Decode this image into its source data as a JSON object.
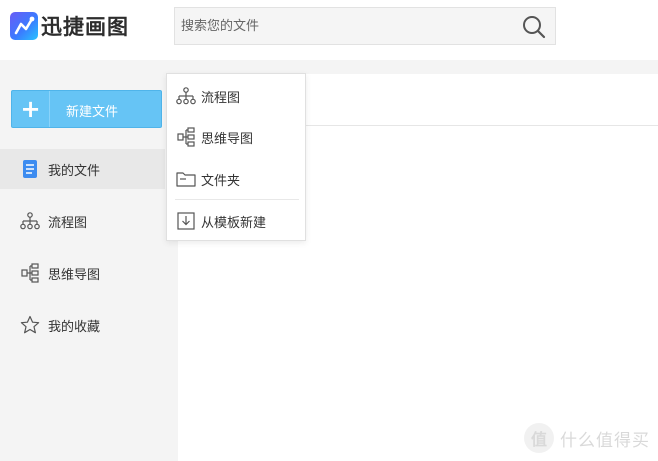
{
  "app": {
    "name": "迅捷画图"
  },
  "search": {
    "placeholder": "搜索您的文件"
  },
  "sidebar": {
    "new_button_label": "新建文件",
    "items": [
      {
        "label": "我的文件",
        "icon": "document-icon",
        "active": true
      },
      {
        "label": "流程图",
        "icon": "flowchart-icon",
        "active": false
      },
      {
        "label": "思维导图",
        "icon": "mindmap-icon",
        "active": false
      },
      {
        "label": "我的收藏",
        "icon": "star-icon",
        "active": false
      }
    ]
  },
  "dropdown": {
    "items": [
      {
        "label": "流程图",
        "icon": "flowchart-icon"
      },
      {
        "label": "思维导图",
        "icon": "mindmap-icon"
      },
      {
        "label": "文件夹",
        "icon": "folder-icon"
      },
      {
        "label": "从模板新建",
        "icon": "template-download-icon"
      }
    ]
  },
  "watermark": {
    "text": "什么值得买",
    "badge": "值"
  },
  "colors": {
    "accent": "#66c4f5",
    "sidebar_bg": "#f4f4f4",
    "active_bg": "#e8e8e8",
    "doc_icon": "#3d8cf0"
  }
}
